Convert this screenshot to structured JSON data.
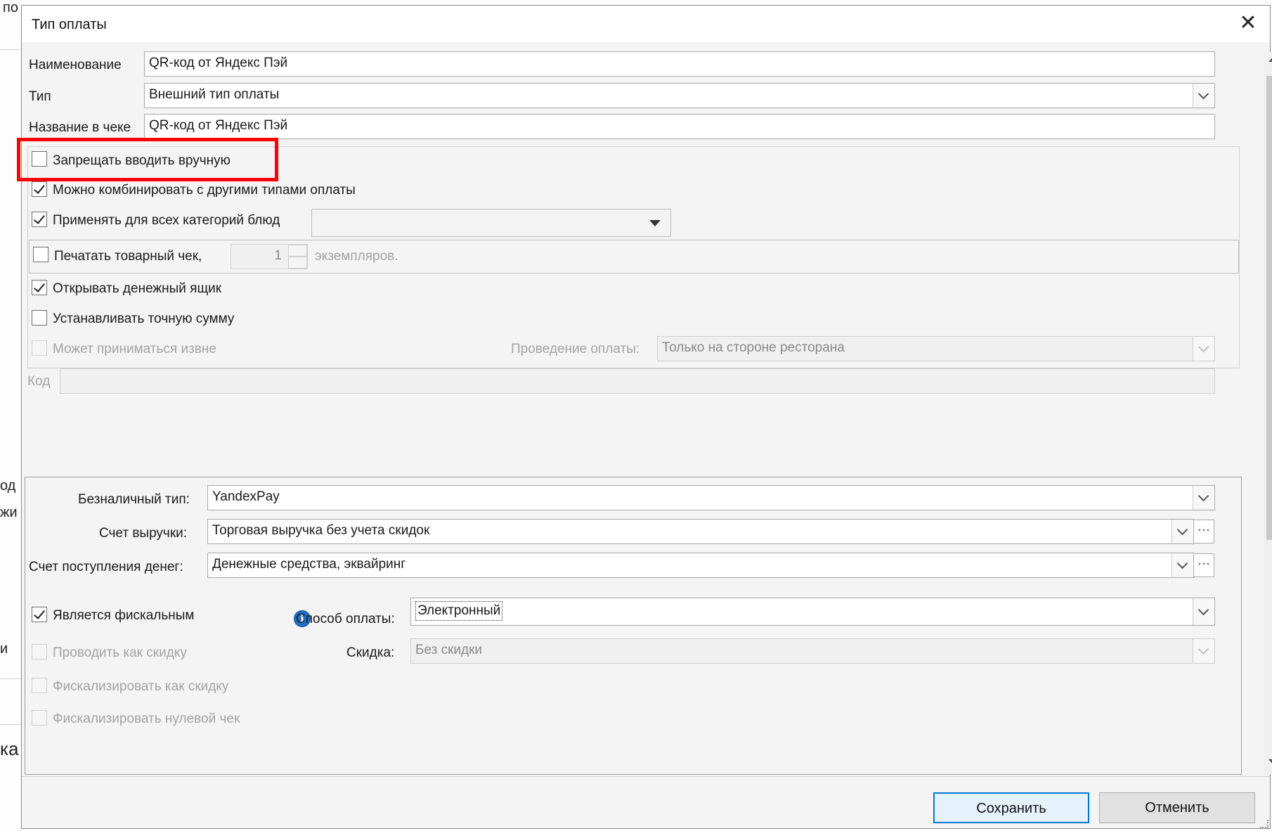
{
  "background": {
    "fragments": [
      "по",
      "од",
      "жи",
      "и",
      "ка"
    ]
  },
  "dialog": {
    "title": "Тип оплаты",
    "close_glyph": "✕",
    "fields": {
      "name_label": "Наименование",
      "name_value": "QR-код от Яндекс Пэй",
      "type_label": "Тип",
      "type_value": "Внешний тип оплаты",
      "receipt_label": "Название в чеке",
      "receipt_value": "QR-код от Яндекс Пэй"
    },
    "options": {
      "prohibit_manual": {
        "label": "Запрещать вводить вручную",
        "checked": false
      },
      "combine": {
        "label": "Можно комбинировать с другими типами оплаты",
        "checked": true
      },
      "apply_all": {
        "label": "Применять для всех категорий блюд",
        "checked": true
      },
      "print_receipt": {
        "label": "Печатать товарный чек,",
        "copies": "1",
        "copies_suffix": "экземпляров.",
        "checked": false
      },
      "open_drawer": {
        "label": "Открывать денежный ящик",
        "checked": true
      },
      "exact_sum": {
        "label": "Устанавливать точную сумму",
        "checked": false
      },
      "external": {
        "label": "Может приниматься извне",
        "checked": false
      },
      "processing_label": "Проведение оплаты:",
      "processing_value": "Только на стороне ресторана",
      "code_label": "Код"
    },
    "lower": {
      "cashless_label": "Безналичный тип:",
      "cashless_value": "YandexPay",
      "revenue_label": "Счет выручки:",
      "revenue_value": "Торговая выручка без учета скидок",
      "incoming_label": "Счет поступления денег:",
      "incoming_value": "Денежные средства, эквайринг",
      "ellipsis": "···",
      "fiscal": {
        "label": "Является фискальным",
        "checked": true
      },
      "method_label": "Способ оплаты:",
      "method_value": "Электронный",
      "as_discount": {
        "label": "Проводить как скидку",
        "checked": false
      },
      "discount_label": "Скидка:",
      "discount_value": "Без скидки",
      "fiscal_discount": {
        "label": "Фискализировать как скидку",
        "checked": false
      },
      "fiscal_zero": {
        "label": "Фискализировать нулевой чек",
        "checked": false
      }
    },
    "buttons": {
      "save": "Сохранить",
      "cancel": "Отменить"
    },
    "highlight_color": "#ff0000",
    "accent_color": "#0078d7"
  }
}
